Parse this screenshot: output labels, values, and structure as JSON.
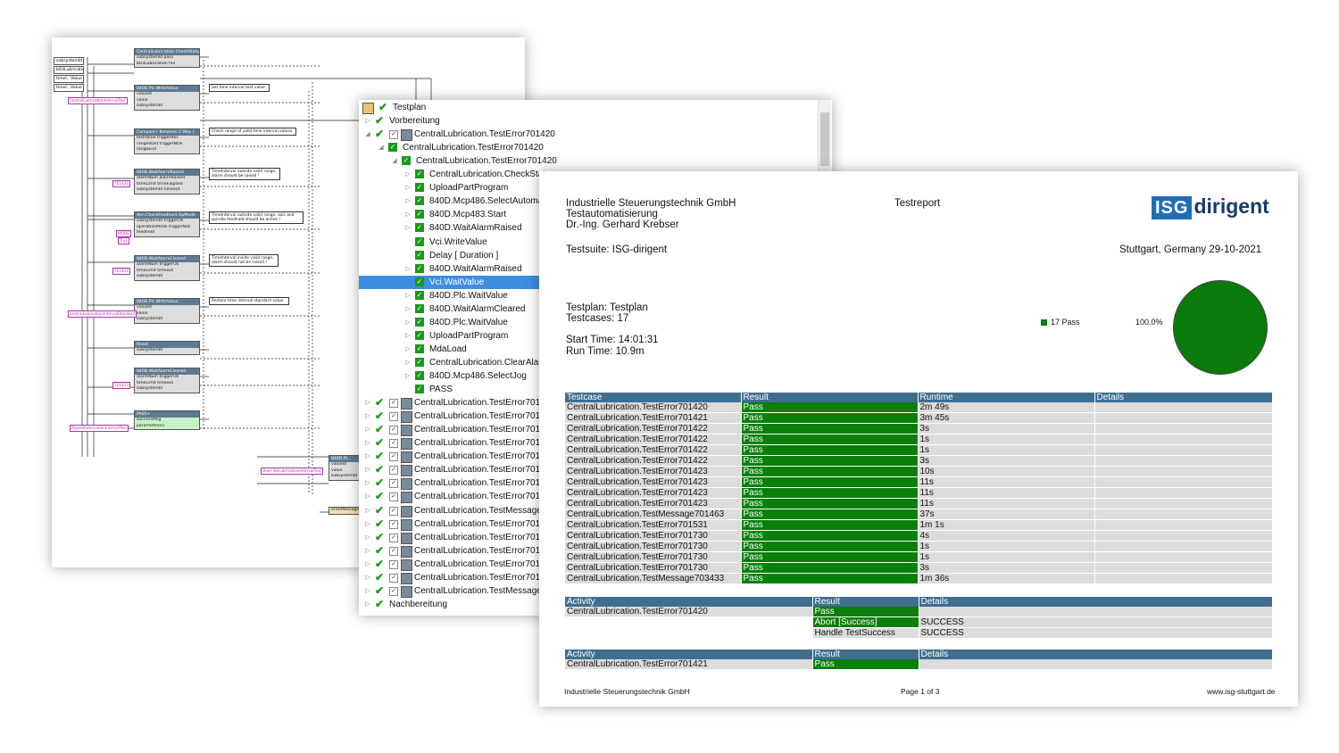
{
  "diagram": {
    "vars": [
      "subsystemId",
      "bOilLubrication",
      "timeI...Value",
      "timeI...Value"
    ],
    "nodes": [
      {
        "title": "CentralLubrication.CheckStatus",
        "lines": [
          "subsystemId    pass",
          "bOilLubrication    fail"
        ]
      },
      {
        "title": "840D.Plc.WriteValue",
        "lines": [
          "valueId",
          "value",
          "subsystemId"
        ]
      },
      {
        "title": "Compare [ Between 2 Way ]",
        "lines": [
          "testValue    triggerRes",
          "rangeStart    triggerNOk",
          "rangeEnd"
        ]
      },
      {
        "title": "840D.WaitAlarmRaised",
        "lines": [
          "alarmNum    alarmRaised",
          "timeLimit    timeElapsed",
          "subsystemId    timeout"
        ]
      },
      {
        "title": "Aen.CheckFeedhold.OpMode",
        "lines": [
          "subsystemId    triggerOk",
          "operationMode    triggerNok",
          "feedhold"
        ]
      },
      {
        "title": "840D.WaitAlarmCleared",
        "lines": [
          "alarmNum    triggerOk",
          "timeLimit    timeout",
          "subsystemId"
        ]
      },
      {
        "title": "840D.Plc.WriteValue",
        "lines": [
          "valueId",
          "value",
          "subsystemId"
        ]
      },
      {
        "title": "Reset",
        "lines": [
          "subsystemId"
        ]
      },
      {
        "title": "840D.WaitAlarmCleared",
        "lines": [
          "alarmNum    triggerOk",
          "timeLimit    timeout",
          "subsystemId"
        ]
      },
      {
        "title": "PASS+",
        "lines": [
          "successMsg",
          "parameter[0]"
        ]
      }
    ],
    "comments": [
      "Set time interval test value",
      "Check range of valid time interval values",
      "TimeInterval outside valid range, alarm should be raised !",
      "TimeInterval outside valid range, axis and spindle feedhold should be active !",
      "TimeInterval inside valid range, alarm should not be raised !",
      "Restore time interval standard value"
    ],
    "pink_labels": [
      "CentralLubricationIntervalTest",
      "701420",
      "MODE",
      "True",
      "701421",
      "centralLubricationIntervalStandard",
      "701423",
      "PassedLubricationIntervalTest",
      "OverrideLubricationIntervalTest"
    ],
    "tail_node": {
      "title": "840D.Pl...",
      "lines": [
        "valueId",
        "value",
        "subsystemId"
      ]
    },
    "error_node": "errorMessage"
  },
  "tree": {
    "rows": [
      {
        "label": "Testplan",
        "level": 0,
        "arrow": "",
        "check": true,
        "box": false,
        "icon": "plan"
      },
      {
        "label": "Vorbereitung",
        "level": 0,
        "arrow": "▷",
        "check": true,
        "box": false,
        "icon": ""
      },
      {
        "label": "CentralLubrication.TestError701420",
        "level": 0,
        "arrow": "◢",
        "check": true,
        "box": true,
        "icon": "module"
      },
      {
        "label": "CentralLubrication.TestError701420",
        "level": 1,
        "arrow": "◢",
        "check": false,
        "box": false,
        "icon": "green"
      },
      {
        "label": "CentralLubrication.TestError701420",
        "level": 2,
        "arrow": "◢",
        "check": false,
        "box": false,
        "icon": "green"
      },
      {
        "label": "CentralLubrication.CheckStatus",
        "level": 3,
        "arrow": "▷",
        "check": false,
        "box": false,
        "icon": "green"
      },
      {
        "label": "UploadPartProgram",
        "level": 3,
        "arrow": "▷",
        "check": false,
        "box": false,
        "icon": "green"
      },
      {
        "label": "840D.Mcp486.SelectAutomatic",
        "level": 3,
        "arrow": "▷",
        "check": false,
        "box": false,
        "icon": "green"
      },
      {
        "label": "840D.Mcp483.Start",
        "level": 3,
        "arrow": "▷",
        "check": false,
        "box": false,
        "icon": "green"
      },
      {
        "label": "840D.WaitAlarmRaised",
        "level": 3,
        "arrow": "▷",
        "check": false,
        "box": false,
        "icon": "green"
      },
      {
        "label": "Vci.WriteValue",
        "level": 3,
        "arrow": "",
        "check": false,
        "box": false,
        "icon": "green"
      },
      {
        "label": "Delay [ Duration ]",
        "level": 3,
        "arrow": "",
        "check": false,
        "box": false,
        "icon": "green"
      },
      {
        "label": "840D.WaitAlarmRaised",
        "level": 3,
        "arrow": "▷",
        "check": false,
        "box": false,
        "icon": "green"
      },
      {
        "label": "Vci.WaitValue",
        "level": 3,
        "arrow": "",
        "check": false,
        "box": false,
        "icon": "green",
        "selected": true
      },
      {
        "label": "840D.Plc.WaitValue",
        "level": 3,
        "arrow": "▷",
        "check": false,
        "box": false,
        "icon": "green"
      },
      {
        "label": "840D.WaitAlarmCleared",
        "level": 3,
        "arrow": "▷",
        "check": false,
        "box": false,
        "icon": "green"
      },
      {
        "label": "840D.Plc.WaitValue",
        "level": 3,
        "arrow": "▷",
        "check": false,
        "box": false,
        "icon": "green"
      },
      {
        "label": "UploadPartProgram",
        "level": 3,
        "arrow": "▷",
        "check": false,
        "box": false,
        "icon": "green"
      },
      {
        "label": "MdaLoad",
        "level": 3,
        "arrow": "▷",
        "check": false,
        "box": false,
        "icon": "green"
      },
      {
        "label": "CentralLubrication.ClearAlarm",
        "level": 3,
        "arrow": "▷",
        "check": false,
        "box": false,
        "icon": "green"
      },
      {
        "label": "840D.Mcp486.SelectJog",
        "level": 3,
        "arrow": "▷",
        "check": false,
        "box": false,
        "icon": "green"
      },
      {
        "label": "PASS",
        "level": 3,
        "arrow": "",
        "check": false,
        "box": false,
        "icon": "green"
      },
      {
        "label": "CentralLubrication.TestError701421",
        "level": 0,
        "arrow": "▷",
        "check": true,
        "box": true,
        "icon": "module"
      },
      {
        "label": "CentralLubrication.TestError701422",
        "level": 0,
        "arrow": "▷",
        "check": true,
        "box": true,
        "icon": "module"
      },
      {
        "label": "CentralLubrication.TestError701422",
        "level": 0,
        "arrow": "▷",
        "check": true,
        "box": true,
        "icon": "module"
      },
      {
        "label": "CentralLubrication.TestError701422",
        "level": 0,
        "arrow": "▷",
        "check": true,
        "box": true,
        "icon": "module"
      },
      {
        "label": "CentralLubrication.TestError701423",
        "level": 0,
        "arrow": "▷",
        "check": true,
        "box": true,
        "icon": "module"
      },
      {
        "label": "CentralLubrication.TestError701423",
        "level": 0,
        "arrow": "▷",
        "check": true,
        "box": true,
        "icon": "module"
      },
      {
        "label": "CentralLubrication.TestError701423",
        "level": 0,
        "arrow": "▷",
        "check": true,
        "box": true,
        "icon": "module"
      },
      {
        "label": "CentralLubrication.TestError701423",
        "level": 0,
        "arrow": "▷",
        "check": true,
        "box": true,
        "icon": "module"
      },
      {
        "label": "CentralLubrication.TestMessage701463",
        "level": 0,
        "arrow": "▷",
        "check": true,
        "box": true,
        "icon": "module"
      },
      {
        "label": "CentralLubrication.TestError701531",
        "level": 0,
        "arrow": "▷",
        "check": true,
        "box": true,
        "icon": "module"
      },
      {
        "label": "CentralLubrication.TestError701730",
        "level": 0,
        "arrow": "▷",
        "check": true,
        "box": true,
        "icon": "module"
      },
      {
        "label": "CentralLubrication.TestError701730",
        "level": 0,
        "arrow": "▷",
        "check": true,
        "box": true,
        "icon": "module"
      },
      {
        "label": "CentralLubrication.TestError701730",
        "level": 0,
        "arrow": "▷",
        "check": true,
        "box": true,
        "icon": "module"
      },
      {
        "label": "CentralLubrication.TestError701730",
        "level": 0,
        "arrow": "▷",
        "check": true,
        "box": true,
        "icon": "module"
      },
      {
        "label": "CentralLubrication.TestMessage703433",
        "level": 0,
        "arrow": "▷",
        "check": true,
        "box": true,
        "icon": "module"
      },
      {
        "label": "Nachbereitung",
        "level": 0,
        "arrow": "▷",
        "check": true,
        "box": false,
        "icon": ""
      }
    ]
  },
  "report": {
    "company": "Industrielle Steuerungstechnik GmbH",
    "department": "Testautomatisierung",
    "author": "Dr.-Ing. Gerhard Krebser",
    "doc_title": "Testreport",
    "logo_isg": "ISG",
    "logo_dirigent": "dirigent",
    "testsuite": "Testsuite: ISG-dirigent",
    "location_date": "Stuttgart, Germany 29-10-2021",
    "testplan": "Testplan: Testplan",
    "testcases": "Testcases: 17",
    "start_time": "Start Time: 14:01:31",
    "run_time": "Run Time: 10.9m",
    "legend_label": "17 Pass",
    "pie_percent": "100.0%",
    "pie_colors": {
      "pass": "#0a7a0a"
    },
    "pass_fraction": 1.0,
    "testcase_table": {
      "headers": [
        "Testcase",
        "Result",
        "Runtime",
        "Details"
      ],
      "rows": [
        [
          "CentralLubrication.TestError701420",
          "Pass",
          "2m 49s",
          ""
        ],
        [
          "CentralLubrication.TestError701421",
          "Pass",
          "3m 45s",
          ""
        ],
        [
          "CentralLubrication.TestError701422",
          "Pass",
          "3s",
          ""
        ],
        [
          "CentralLubrication.TestError701422",
          "Pass",
          "1s",
          ""
        ],
        [
          "CentralLubrication.TestError701422",
          "Pass",
          "1s",
          ""
        ],
        [
          "CentralLubrication.TestError701422",
          "Pass",
          "3s",
          ""
        ],
        [
          "CentralLubrication.TestError701423",
          "Pass",
          "10s",
          ""
        ],
        [
          "CentralLubrication.TestError701423",
          "Pass",
          "11s",
          ""
        ],
        [
          "CentralLubrication.TestError701423",
          "Pass",
          "11s",
          ""
        ],
        [
          "CentralLubrication.TestError701423",
          "Pass",
          "11s",
          ""
        ],
        [
          "CentralLubrication.TestMessage701463",
          "Pass",
          "37s",
          ""
        ],
        [
          "CentralLubrication.TestError701531",
          "Pass",
          "1m 1s",
          ""
        ],
        [
          "CentralLubrication.TestError701730",
          "Pass",
          "4s",
          ""
        ],
        [
          "CentralLubrication.TestError701730",
          "Pass",
          "1s",
          ""
        ],
        [
          "CentralLubrication.TestError701730",
          "Pass",
          "1s",
          ""
        ],
        [
          "CentralLubrication.TestError701730",
          "Pass",
          "3s",
          ""
        ],
        [
          "CentralLubrication.TestMessage703433",
          "Pass",
          "1m 36s",
          ""
        ]
      ]
    },
    "activity_table_1": {
      "headers": [
        "Activity",
        "Result",
        "Details"
      ],
      "rows": [
        [
          "CentralLubrication.TestError701420",
          "Pass",
          ""
        ],
        [
          "",
          "Abort [Success]",
          "SUCCESS"
        ],
        [
          "",
          "Handle TestSuccess",
          "SUCCESS"
        ]
      ]
    },
    "activity_table_2": {
      "headers": [
        "Activity",
        "Result",
        "Details"
      ],
      "rows": [
        [
          "CentralLubrication.TestError701421",
          "Pass",
          ""
        ]
      ]
    },
    "footer_left": "Industrielle Steuerungstechnik GmbH",
    "footer_center": "Page 1 of 3",
    "footer_right": "www.isg-stuttgart.de"
  }
}
